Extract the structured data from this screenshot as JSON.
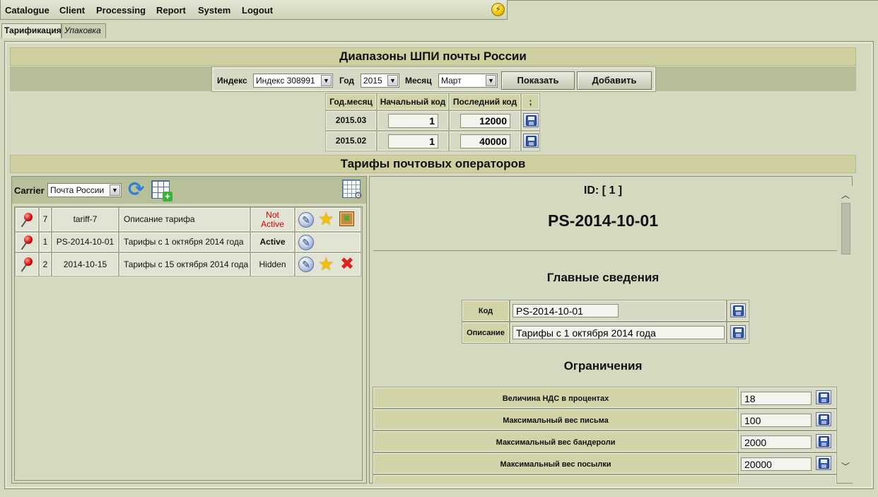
{
  "menu": [
    "Catalogue",
    "Client",
    "Processing",
    "Report",
    "System",
    "Logout"
  ],
  "tabs": {
    "active": "Тарификация",
    "other": "Упаковка"
  },
  "range_section": {
    "title": "Диапазоны ШПИ почты России",
    "filter": {
      "index_label": "Индекс",
      "index_value": "Индекс 308991",
      "year_label": "Год",
      "year_value": "2015",
      "month_label": "Месяц",
      "month_value": "Март",
      "show_button": "Показать",
      "add_button": "Добавить"
    },
    "table": {
      "headers": [
        "Год.месяц",
        "Начальный код",
        "Последний код",
        ";"
      ],
      "rows": [
        {
          "period": "2015.03",
          "start": "1",
          "end": "12000"
        },
        {
          "period": "2015.02",
          "start": "1",
          "end": "40000"
        }
      ]
    }
  },
  "tariff_section": {
    "title": "Тарифы почтовых операторов",
    "carrier_label": "Carrier",
    "carrier_value": "Почта России",
    "rows": [
      {
        "id": "7",
        "code": "tariff-7",
        "desc": "Описание тарифа",
        "status": "Not Active",
        "status_color": "#d00000"
      },
      {
        "id": "1",
        "code": "PS-2014-10-01",
        "desc": "Тарифы с 1 октября 2014 года",
        "status": "Active",
        "status_color": "#000000"
      },
      {
        "id": "2",
        "code": "2014-10-15",
        "desc": "Тарифы с 15 октября 2014 года",
        "status": "Hidden",
        "status_color": "#000000"
      }
    ]
  },
  "detail": {
    "id_text": "ID: [ 1 ]",
    "name": "PS-2014-10-01",
    "main_heading": "Главные сведения",
    "code_label": "Код",
    "code_value": "PS-2014-10-01",
    "desc_label": "Описание",
    "desc_value": "Тарифы с 1 октября 2014 года",
    "limits_heading": "Ограничения",
    "limits": [
      {
        "label": "Величина НДС в процентах",
        "value": "18"
      },
      {
        "label": "Максимальный вес письма",
        "value": "100"
      },
      {
        "label": "Максимальный вес бандероли",
        "value": "2000"
      },
      {
        "label": "Максимальный вес посылки",
        "value": "20000"
      }
    ]
  },
  "icons": {
    "menu_status": "lightning-icon",
    "refresh": "refresh-icon",
    "add_table": "add-table-icon",
    "table_settings": "table-settings-icon",
    "pin": "pushpin-icon",
    "edit": "edit-icon",
    "star": "star-icon",
    "package": "package-icon",
    "delete": "delete-icon",
    "save": "floppy-save-icon"
  }
}
